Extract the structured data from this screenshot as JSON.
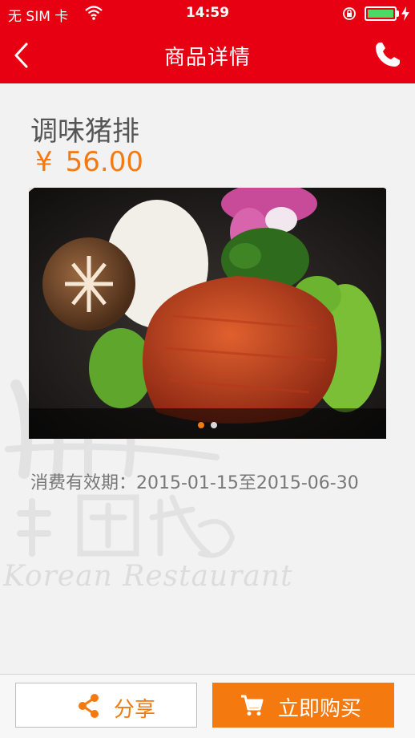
{
  "status_bar": {
    "carrier": "无 SIM 卡",
    "time": "14:59",
    "battery_level": 1.0
  },
  "nav": {
    "title": "商品详情",
    "back_icon": "chevron-left-icon",
    "right_icon": "phone-icon"
  },
  "product": {
    "name": "调味猪排",
    "currency": "¥",
    "price": "56.00",
    "validity": "消费有效期：2015-01-15至2015-06-30"
  },
  "gallery": {
    "image_count": 2,
    "active_index": 0
  },
  "actions": {
    "share_label": "分享",
    "buy_label": "立即购买"
  },
  "colors": {
    "header": "#e60012",
    "accent": "#f47a10",
    "background": "#f2f2f2"
  }
}
